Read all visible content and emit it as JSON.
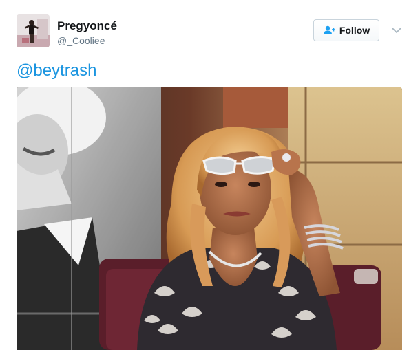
{
  "user": {
    "display_name": "Pregyoncé",
    "screen_name": "@_Cooliee",
    "avatar_icon": "avatar-photo-icon"
  },
  "follow_button": {
    "label": "Follow",
    "icon": "add-user-icon",
    "color": "#1da1f2"
  },
  "menu": {
    "icon": "chevron-down-icon"
  },
  "tweet": {
    "text": "@beytrash",
    "link_color": "#1b95e0"
  },
  "media": {
    "type": "photo",
    "icon": "tweet-photo-icon"
  }
}
